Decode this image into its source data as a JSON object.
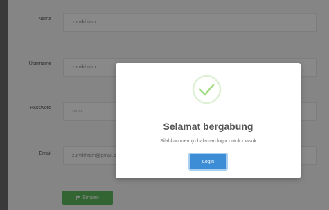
{
  "form": {
    "nama_label": "Nama",
    "nama_value": "zurvikhram",
    "username_label": "Username",
    "username_value": "zurvikhram",
    "password_label": "Password",
    "password_value": "••••••",
    "email_label": "Email",
    "email_value": "zurvikhram@gmail.com",
    "save_icon": "save-icon",
    "save_label": "Simpan"
  },
  "modal": {
    "icon": "checkmark-circle-icon",
    "title": "Selamat bergabung",
    "text": "Silahkan menuju halaman login untuk masuk",
    "login_label": "Login"
  },
  "colors": {
    "success": "#a5dc86",
    "primary": "#3c8dd6",
    "save_button": "#5cb85c"
  }
}
